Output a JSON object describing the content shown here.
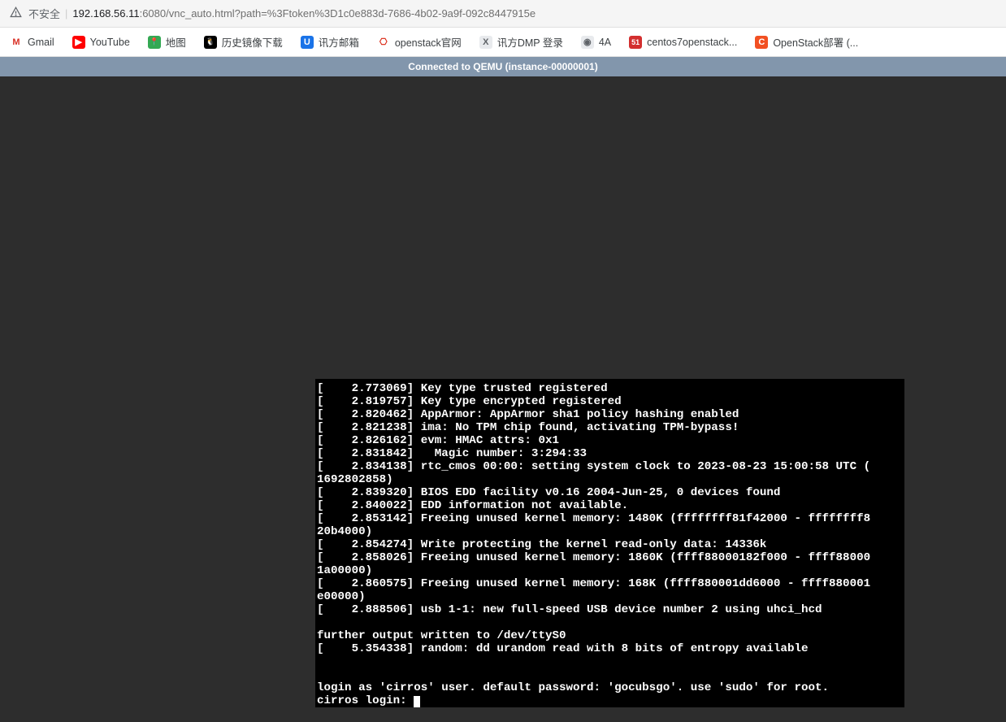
{
  "address_bar": {
    "security_label": "不安全",
    "url_host": "192.168.56.11",
    "url_port": ":6080",
    "url_path": "/vnc_auto.html?path=%3Ftoken%3D1c0e883d-7686-4b02-9a9f-092c8447915e"
  },
  "bookmarks": [
    {
      "label": "Gmail",
      "icon_bg": "#fff",
      "icon_fg": "#d93025",
      "glyph": "M"
    },
    {
      "label": "YouTube",
      "icon_bg": "#ff0000",
      "icon_fg": "#fff",
      "glyph": "▶"
    },
    {
      "label": "地图",
      "icon_bg": "#34a853",
      "icon_fg": "#fff",
      "glyph": "📍"
    },
    {
      "label": "历史镜像下载",
      "icon_bg": "#000",
      "icon_fg": "#fff",
      "glyph": "🐧"
    },
    {
      "label": "讯方邮箱",
      "icon_bg": "#1a73e8",
      "icon_fg": "#fff",
      "glyph": "U"
    },
    {
      "label": "openstack官网",
      "icon_bg": "#fff",
      "icon_fg": "#d9230f",
      "glyph": "⎔"
    },
    {
      "label": "讯方DMP 登录",
      "icon_bg": "#e8eaed",
      "icon_fg": "#5f6368",
      "glyph": "X"
    },
    {
      "label": "4A",
      "icon_bg": "#e8eaed",
      "icon_fg": "#5f6368",
      "glyph": "◉"
    },
    {
      "label": "centos7openstack...",
      "icon_bg": "#d32f2f",
      "icon_fg": "#fff",
      "glyph": "51"
    },
    {
      "label": "OpenStack部署 (...",
      "icon_bg": "#f25022",
      "icon_fg": "#fff",
      "glyph": "C"
    }
  ],
  "status": "Connected to QEMU (instance-00000001)",
  "terminal_lines": [
    "[    2.773069] Key type trusted registered",
    "[    2.819757] Key type encrypted registered",
    "[    2.820462] AppArmor: AppArmor sha1 policy hashing enabled",
    "[    2.821238] ima: No TPM chip found, activating TPM-bypass!",
    "[    2.826162] evm: HMAC attrs: 0x1",
    "[    2.831842]   Magic number: 3:294:33",
    "[    2.834138] rtc_cmos 00:00: setting system clock to 2023-08-23 15:00:58 UTC (",
    "1692802858)",
    "[    2.839320] BIOS EDD facility v0.16 2004-Jun-25, 0 devices found",
    "[    2.840022] EDD information not available.",
    "[    2.853142] Freeing unused kernel memory: 1480K (ffffffff81f42000 - ffffffff8",
    "20b4000)",
    "[    2.854274] Write protecting the kernel read-only data: 14336k",
    "[    2.858026] Freeing unused kernel memory: 1860K (ffff88000182f000 - ffff88000",
    "1a00000)",
    "[    2.860575] Freeing unused kernel memory: 168K (ffff880001dd6000 - ffff880001",
    "e00000)",
    "[    2.888506] usb 1-1: new full-speed USB device number 2 using uhci_hcd",
    "",
    "further output written to /dev/ttyS0",
    "[    5.354338] random: dd urandom read with 8 bits of entropy available",
    "",
    "",
    "login as 'cirros' user. default password: 'gocubsgo'. use 'sudo' for root.",
    "cirros login: "
  ]
}
